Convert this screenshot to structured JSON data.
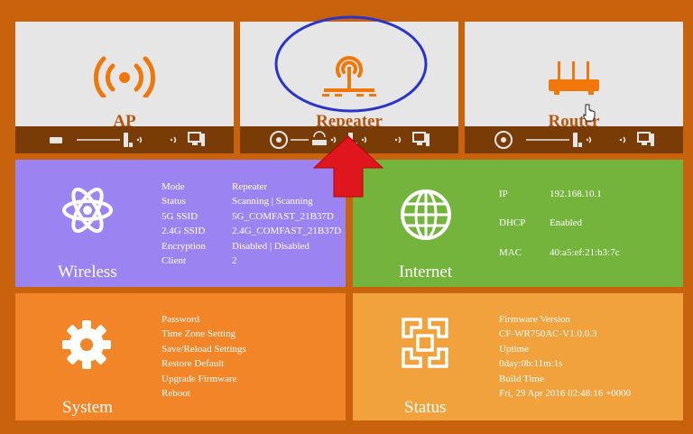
{
  "modes": [
    {
      "label": "AP"
    },
    {
      "label": "Repeater"
    },
    {
      "label": "Router"
    }
  ],
  "wireless": {
    "title": "Wireless",
    "rows": [
      {
        "key": "Mode",
        "value": "Repeater"
      },
      {
        "key": "Status",
        "value": "Scanning | Scanning"
      },
      {
        "key": "5G SSID",
        "value": "5G_COMFAST_21B37D"
      },
      {
        "key": "2.4G SSID",
        "value": "2.4G_COMFAST_21B37D"
      },
      {
        "key": "Encryption",
        "value": "Disabled | Disabled"
      },
      {
        "key": "Client",
        "value": "2"
      }
    ],
    "color": "#9c83f2"
  },
  "internet": {
    "title": "Internet",
    "rows": [
      {
        "key": "IP",
        "value": "192.168.10.1"
      },
      {
        "key": "DHCP",
        "value": "Enabled"
      },
      {
        "key": "MAC",
        "value": "40:a5:ef:21:b3:7c"
      }
    ],
    "color": "#74b43c"
  },
  "system": {
    "title": "System",
    "items": [
      "Password",
      "Time Zone Setting",
      "Save/Reload Settings",
      "Restore Default",
      "Upgrade Firmware",
      "Reboot"
    ],
    "color": "#f18528"
  },
  "status": {
    "title": "Status",
    "lines": [
      "Firmware Version",
      "CF-WR750AC-V1.0.0.3",
      "Uptime",
      "0day:0h:11m:1s",
      "Build Time",
      "Fri, 29 Apr 2016 02:48:16 +0000"
    ],
    "color": "#f2a23c"
  },
  "colors": {
    "background": "#c8620c",
    "accent": "#f0780a",
    "strip": "#7a3c06",
    "annotation_circle": "#2a35c8",
    "annotation_arrow": "#e0161e"
  }
}
